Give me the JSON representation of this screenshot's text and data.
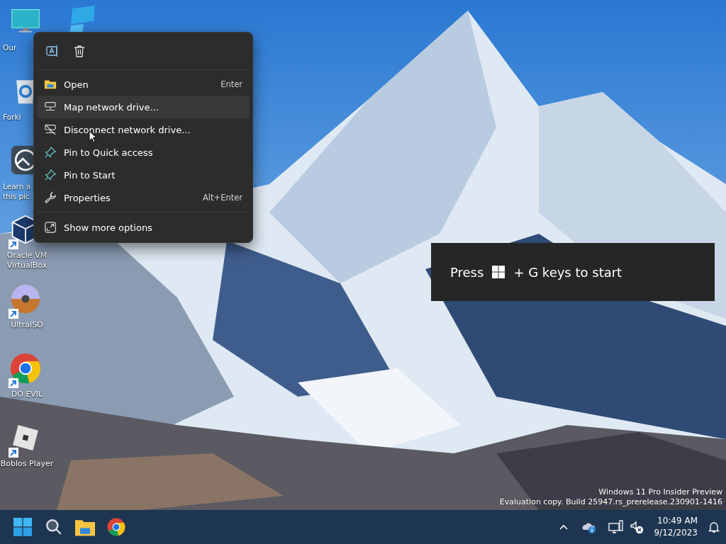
{
  "desktop_icons": [
    {
      "label": "Our",
      "covered": true,
      "shortcut": false
    },
    {
      "label": "Forki",
      "covered": true,
      "shortcut": false
    },
    {
      "label": "Learn a this pic",
      "covered": true,
      "shortcut": false
    },
    {
      "label": "Oracle VM VirtualBox",
      "covered": false,
      "shortcut": true
    },
    {
      "label": "UltraISO",
      "covered": false,
      "shortcut": true
    },
    {
      "label": "DO EVIL",
      "covered": false,
      "shortcut": true
    },
    {
      "label": "Boblos Player",
      "covered": false,
      "shortcut": true
    }
  ],
  "context_menu": {
    "items": [
      {
        "label": "Open",
        "shortcut": "Enter",
        "highlighted": false
      },
      {
        "label": "Map network drive...",
        "highlighted": true
      },
      {
        "label": "Disconnect network drive...",
        "highlighted": false
      },
      {
        "label": "Pin to Quick access",
        "highlighted": false
      },
      {
        "label": "Pin to Start",
        "highlighted": false
      },
      {
        "label": "Properties",
        "shortcut": "Alt+Enter",
        "highlighted": false
      }
    ],
    "footer_item": {
      "label": "Show more options"
    }
  },
  "toast": {
    "before": "Press",
    "after": "+ G keys to start"
  },
  "watermark": [
    "Windows 11 Pro Insider Preview",
    "Evaluation copy. Build 25947.rs_prerelease.230901-1416"
  ],
  "taskbar": {
    "time": "10:49 AM",
    "date": "9/12/2023"
  }
}
